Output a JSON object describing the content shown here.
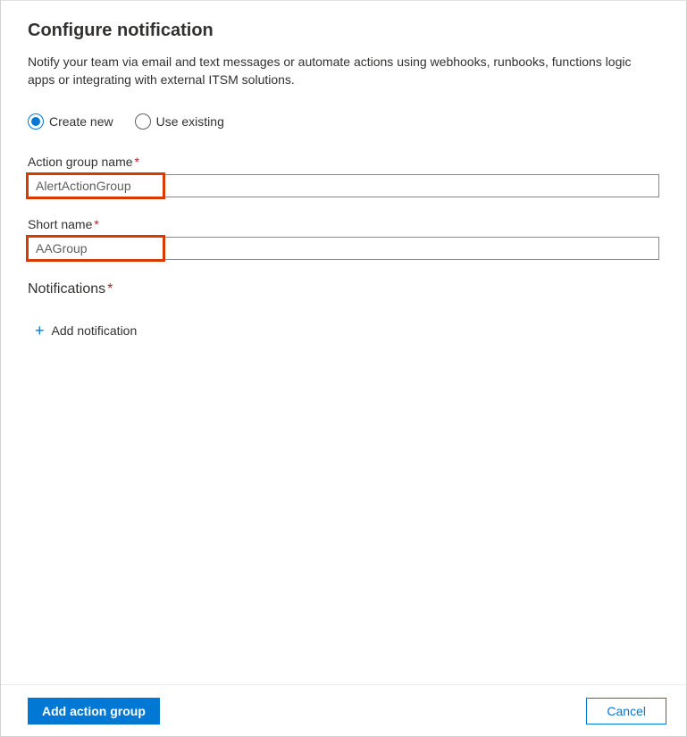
{
  "header": {
    "title": "Configure notification",
    "description": "Notify your team via email and text messages or automate actions using webhooks, runbooks, functions logic apps or integrating with external ITSM solutions."
  },
  "mode": {
    "selected": "create_new",
    "options": {
      "create_new": "Create new",
      "use_existing": "Use existing"
    }
  },
  "fields": {
    "action_group_name": {
      "label": "Action group name",
      "value": "AlertActionGroup",
      "required": true
    },
    "short_name": {
      "label": "Short name",
      "value": "AAGroup",
      "required": true
    }
  },
  "notifications": {
    "header": "Notifications",
    "required": true,
    "add_label": "Add notification"
  },
  "footer": {
    "primary": "Add action group",
    "secondary": "Cancel"
  },
  "required_marker": "*"
}
